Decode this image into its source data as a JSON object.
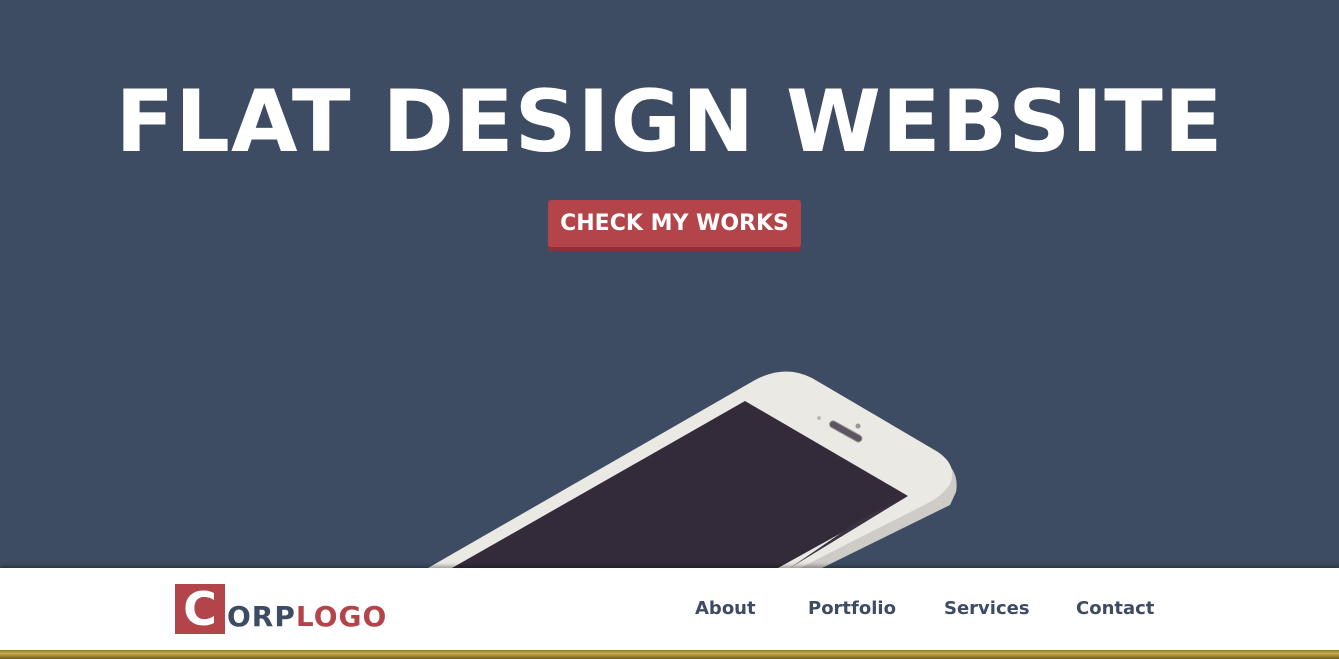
{
  "hero": {
    "title": "FLAT DESIGN WEBSITE",
    "cta_label": "CHECK MY WORKS"
  },
  "navbar": {
    "logo": {
      "initial": "C",
      "corp": "ORP",
      "logo": "LOGO"
    },
    "items": [
      {
        "label": "About"
      },
      {
        "label": "Portfolio"
      },
      {
        "label": "Services"
      },
      {
        "label": "Contact"
      }
    ]
  },
  "colors": {
    "hero_background": "#3e4c63",
    "accent_red": "#b3454a",
    "nav_text": "#3e4c63",
    "navbar_background": "#ffffff",
    "bottom_stripe": "#c9ad45"
  },
  "icons": {
    "hero_illustration": "smartphone-illustration"
  }
}
